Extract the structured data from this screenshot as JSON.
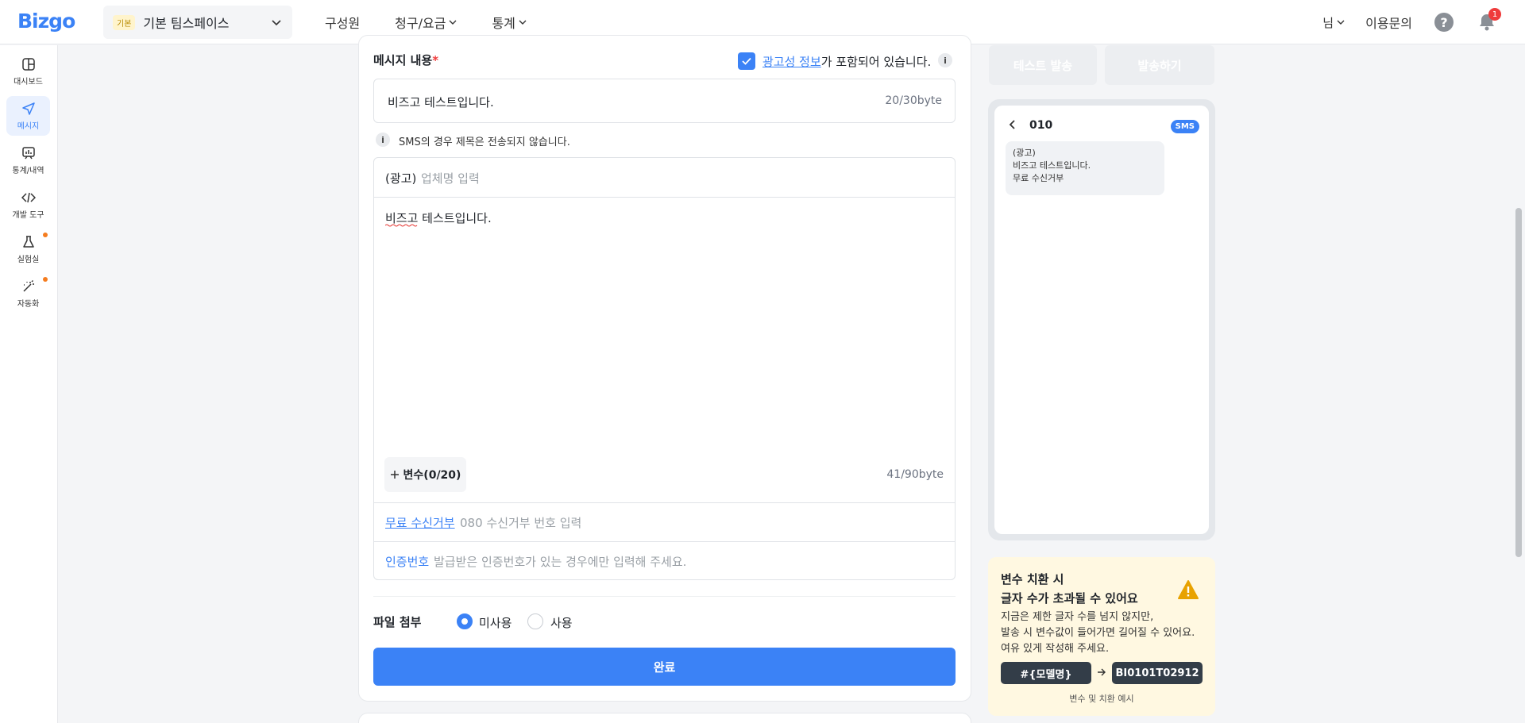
{
  "header": {
    "logo": "Bizgo",
    "workspace_badge": "기본",
    "workspace_name": "기본 팀스페이스",
    "nav": [
      {
        "label": "구성원"
      },
      {
        "label": "청구/요금"
      },
      {
        "label": "통계"
      }
    ],
    "user": "님",
    "inquiry": "이용문의",
    "help": "?",
    "notification_count": "1"
  },
  "sidebar": {
    "items": [
      {
        "label": "대시보드",
        "icon": "dashboard-icon"
      },
      {
        "label": "메시지",
        "icon": "send-icon",
        "active": true
      },
      {
        "label": "통계/내역",
        "icon": "stats-icon"
      },
      {
        "label": "개발 도구",
        "icon": "code-icon"
      },
      {
        "label": "실험실",
        "icon": "flask-icon"
      },
      {
        "label": "자동화",
        "icon": "magic-wand-icon"
      }
    ]
  },
  "form": {
    "title": "메시지 내용",
    "required_mark": "*",
    "ad_checkbox_link": "광고성 정보",
    "ad_checkbox_text": "가 포함되어 있습니다.",
    "ad_checked": true,
    "subject_value": "비즈고 테스트입니다.",
    "subject_count": "20/30byte",
    "sms_note": "SMS의 경우 제목은 전송되지 않습니다.",
    "ad_prefix": "(광고)",
    "company_placeholder": "업체명 입력",
    "body_value": "비즈고 테스트입니다.",
    "variable_button": "변수(0/20)",
    "body_count": "41/90byte",
    "reject_label": "무료 수신거부",
    "reject_placeholder": "080 수신거부 번호 입력",
    "auth_label": "인증번호",
    "auth_placeholder": "발급받은 인증번호가 있는 경우에만 입력해 주세요.",
    "file_title": "파일 첨부",
    "file_options": [
      {
        "label": "미사용",
        "selected": true
      },
      {
        "label": "사용",
        "selected": false
      }
    ],
    "done_button": "완료"
  },
  "preview": {
    "test_send": "테스트 발송",
    "send": "발송하기",
    "sender": "010",
    "type_badge": "SMS",
    "bubble_lines": [
      "(광고)",
      "비즈고 테스트입니다.",
      "무료 수신거부"
    ]
  },
  "warning": {
    "title1": "변수 치환 시",
    "title2": "글자 수가 초과될 수 있어요",
    "body_lines": [
      "지금은 제한 글자 수를 넘지 않지만,",
      "발송 시 변수값이 들어가면 길어질 수 있어요.",
      "여유 있게 작성해 주세요."
    ],
    "chip_from": "#{모델명}",
    "chip_to": "BI0101T02912",
    "caption": "변수 및 치환 예시"
  },
  "colors": {
    "accent": "#3b82f6",
    "required": "#ef3b3b",
    "warning_bg": "#fff8e1",
    "warning_icon": "#e8a200"
  }
}
